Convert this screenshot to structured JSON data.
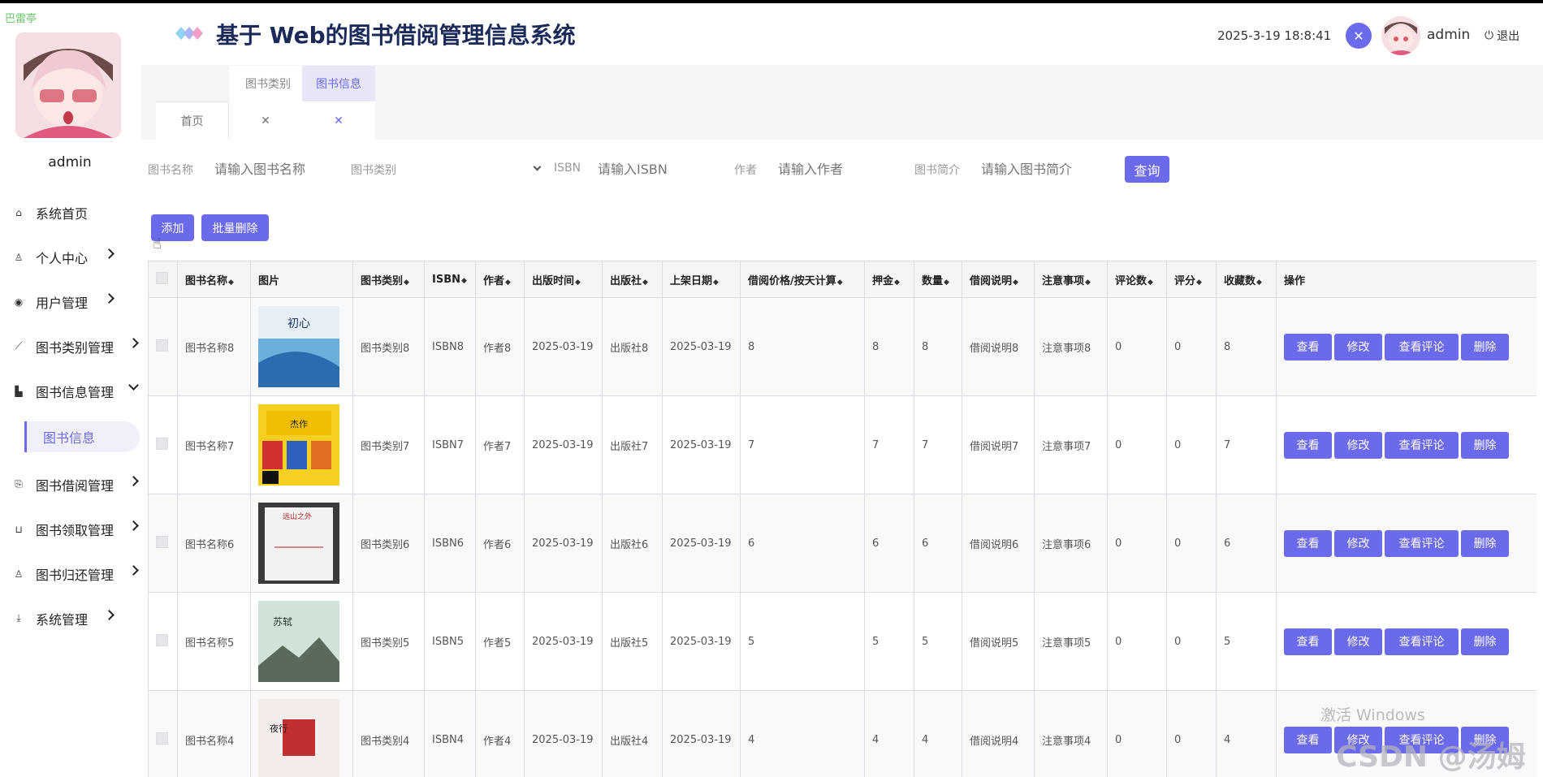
{
  "app": {
    "title": "基于 Web的图书借阅管理信息系统",
    "datetime": "2025-3-19 18:8:41",
    "user": "admin",
    "logout": "退出"
  },
  "sidebar": {
    "watermark": "巴雷亭",
    "user": "admin",
    "menu": [
      "系统首页",
      "个人中心",
      "用户管理",
      "图书类别管理",
      "图书信息管理",
      "图书借阅管理",
      "图书领取管理",
      "图书归还管理",
      "系统管理"
    ],
    "active_sub": "图书信息"
  },
  "tabs": {
    "cat": "图书类别",
    "info": "图书信息",
    "home": "首页"
  },
  "search": {
    "name_label": "图书名称",
    "name_ph": "请输入图书名称",
    "cat_label": "图书类别",
    "isbn_label": "ISBN",
    "isbn_ph": "请输入ISBN",
    "author_label": "作者",
    "author_ph": "请输入作者",
    "intro_label": "图书简介",
    "intro_ph": "请输入图书简介",
    "query": "查询"
  },
  "actions": {
    "add": "添加",
    "batch_delete": "批量删除"
  },
  "table": {
    "headers": [
      "图书名称",
      "图片",
      "图书类别",
      "ISBN",
      "作者",
      "出版时间",
      "出版社",
      "上架日期",
      "借阅价格/按天计算",
      "押金",
      "数量",
      "借阅说明",
      "注意事项",
      "评论数",
      "评分",
      "收藏数",
      "操作"
    ],
    "ops": [
      "查看",
      "修改",
      "查看评论",
      "删除"
    ],
    "rows": [
      [
        "图书名称8",
        "图书类别8",
        "ISBN8",
        "作者8",
        "2025-03-19",
        "出版社8",
        "2025-03-19",
        "8",
        "8",
        "8",
        "借阅说明8",
        "注意事项8",
        "0",
        "0",
        "8"
      ],
      [
        "图书名称7",
        "图书类别7",
        "ISBN7",
        "作者7",
        "2025-03-19",
        "出版社7",
        "2025-03-19",
        "7",
        "7",
        "7",
        "借阅说明7",
        "注意事项7",
        "0",
        "0",
        "7"
      ],
      [
        "图书名称6",
        "图书类别6",
        "ISBN6",
        "作者6",
        "2025-03-19",
        "出版社6",
        "2025-03-19",
        "6",
        "6",
        "6",
        "借阅说明6",
        "注意事项6",
        "0",
        "0",
        "6"
      ],
      [
        "图书名称5",
        "图书类别5",
        "ISBN5",
        "作者5",
        "2025-03-19",
        "出版社5",
        "2025-03-19",
        "5",
        "5",
        "5",
        "借阅说明5",
        "注意事项5",
        "0",
        "0",
        "5"
      ],
      [
        "图书名称4",
        "图书类别4",
        "ISBN4",
        "作者4",
        "2025-03-19",
        "出版社4",
        "2025-03-19",
        "4",
        "4",
        "4",
        "借阅说明4",
        "注意事项4",
        "0",
        "0",
        "4"
      ]
    ]
  },
  "watermarks": {
    "windows": "激活 Windows",
    "csdn": "CSDN @汤姆yu"
  },
  "colors": {
    "accent": "#6a6aea",
    "title": "#1c2a5a"
  }
}
